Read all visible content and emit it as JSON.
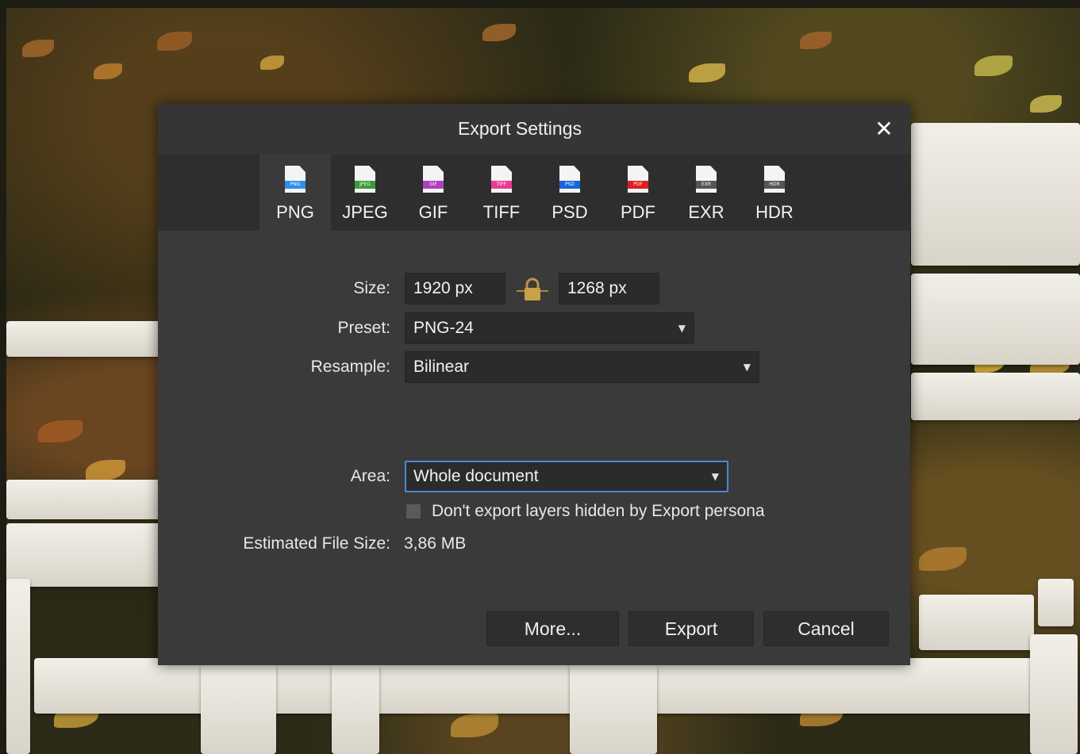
{
  "dialog": {
    "title": "Export Settings",
    "close_glyph": "✕"
  },
  "formats": [
    {
      "label": "PNG",
      "icon": "png-file-icon",
      "band_text": "PNG",
      "band_color": "#2f8fe6",
      "selected": true
    },
    {
      "label": "JPEG",
      "icon": "jpeg-file-icon",
      "band_text": "JPEG",
      "band_color": "#3c9a38",
      "selected": false
    },
    {
      "label": "GIF",
      "icon": "gif-file-icon",
      "band_text": "GIF",
      "band_color": "#b03fbf",
      "selected": false
    },
    {
      "label": "TIFF",
      "icon": "tiff-file-icon",
      "band_text": "TIFF",
      "band_color": "#e83d93",
      "selected": false
    },
    {
      "label": "PSD",
      "icon": "psd-file-icon",
      "band_text": "PSD",
      "band_color": "#1565d8",
      "selected": false
    },
    {
      "label": "PDF",
      "icon": "pdf-file-icon",
      "band_text": "PDF",
      "band_color": "#e11c1c",
      "selected": false
    },
    {
      "label": "EXR",
      "icon": "exr-file-icon",
      "band_text": "EXR",
      "band_color": "#555555",
      "selected": false
    },
    {
      "label": "HDR",
      "icon": "hdr-file-icon",
      "band_text": "HDR",
      "band_color": "#555555",
      "selected": false
    }
  ],
  "form": {
    "size_label": "Size:",
    "width_value": "1920 px",
    "height_value": "1268 px",
    "lock_icon": "lock-icon",
    "preset_label": "Preset:",
    "preset_value": "PNG-24",
    "resample_label": "Resample:",
    "resample_value": "Bilinear",
    "area_label": "Area:",
    "area_value": "Whole document",
    "hidden_layers_label": "Don't export layers hidden by Export persona",
    "hidden_layers_checked": false,
    "est_size_label": "Estimated File Size:",
    "est_size_value": "3,86 MB",
    "dropdown_glyph": "▼"
  },
  "buttons": {
    "more": "More...",
    "export": "Export",
    "cancel": "Cancel"
  },
  "colors": {
    "dialog_bg": "#3a3a3a",
    "focus_border": "#4b88d6",
    "lock_gold": "#c8a24a"
  }
}
